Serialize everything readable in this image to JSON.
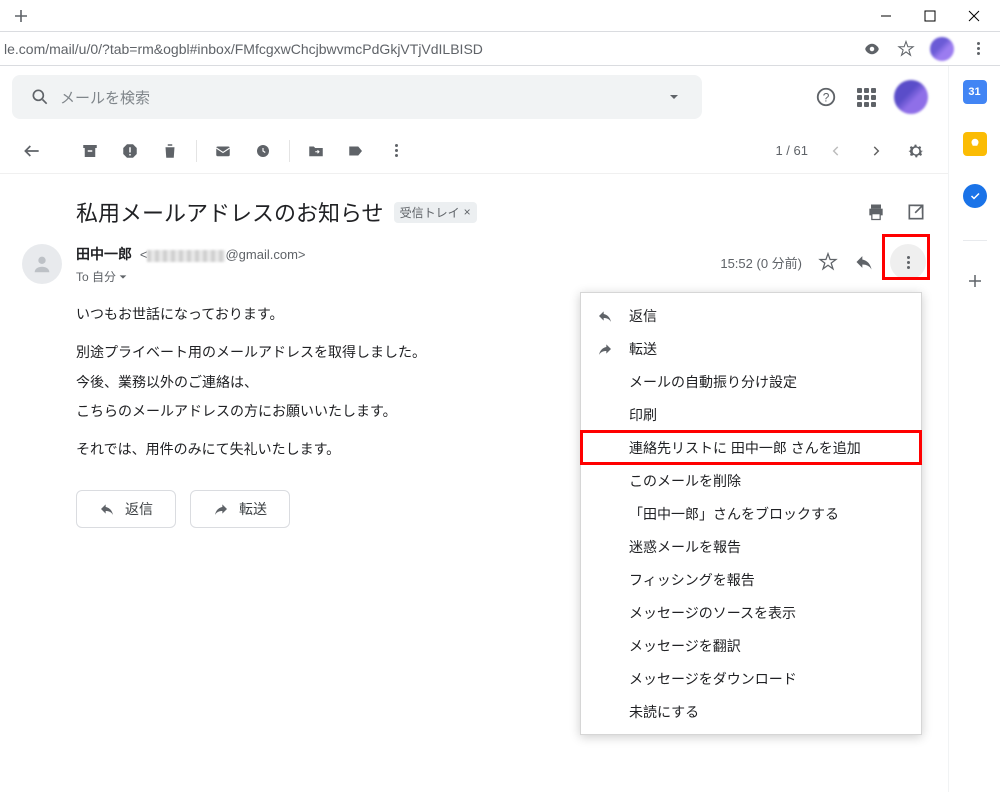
{
  "browser": {
    "url": "le.com/mail/u/0/?tab=rm&ogbl#inbox/FMfcgxwChcjbwvmcPdGkjVTjVdILBISD"
  },
  "search": {
    "placeholder": "メールを検索"
  },
  "toolbar": {
    "count": "1 / 61"
  },
  "subject": {
    "text": "私用メールアドレスのお知らせ",
    "label": "受信トレイ",
    "label_x": "×"
  },
  "sender": {
    "name": "田中一郎",
    "email_suffix": "@gmail.com>",
    "email_prefix": "<",
    "to": "To 自分",
    "time": "15:52 (0 分前)"
  },
  "body": {
    "p1": "いつもお世話になっております。",
    "p2": "別途プライベート用のメールアドレスを取得しました。",
    "p3": "今後、業務以外のご連絡は、",
    "p4": "こちらのメールアドレスの方にお願いいたします。",
    "p5": "それでは、用件のみにて失礼いたします。"
  },
  "buttons": {
    "reply": "返信",
    "forward": "転送"
  },
  "menu": {
    "reply": "返信",
    "forward": "転送",
    "filter": "メールの自動振り分け設定",
    "print": "印刷",
    "add_contact": "連絡先リストに 田中一郎 さんを追加",
    "delete": "このメールを削除",
    "block": "「田中一郎」さんをブロックする",
    "report_spam": "迷惑メールを報告",
    "report_phish": "フィッシングを報告",
    "show_source": "メッセージのソースを表示",
    "translate": "メッセージを翻訳",
    "download": "メッセージをダウンロード",
    "mark_unread": "未読にする"
  }
}
